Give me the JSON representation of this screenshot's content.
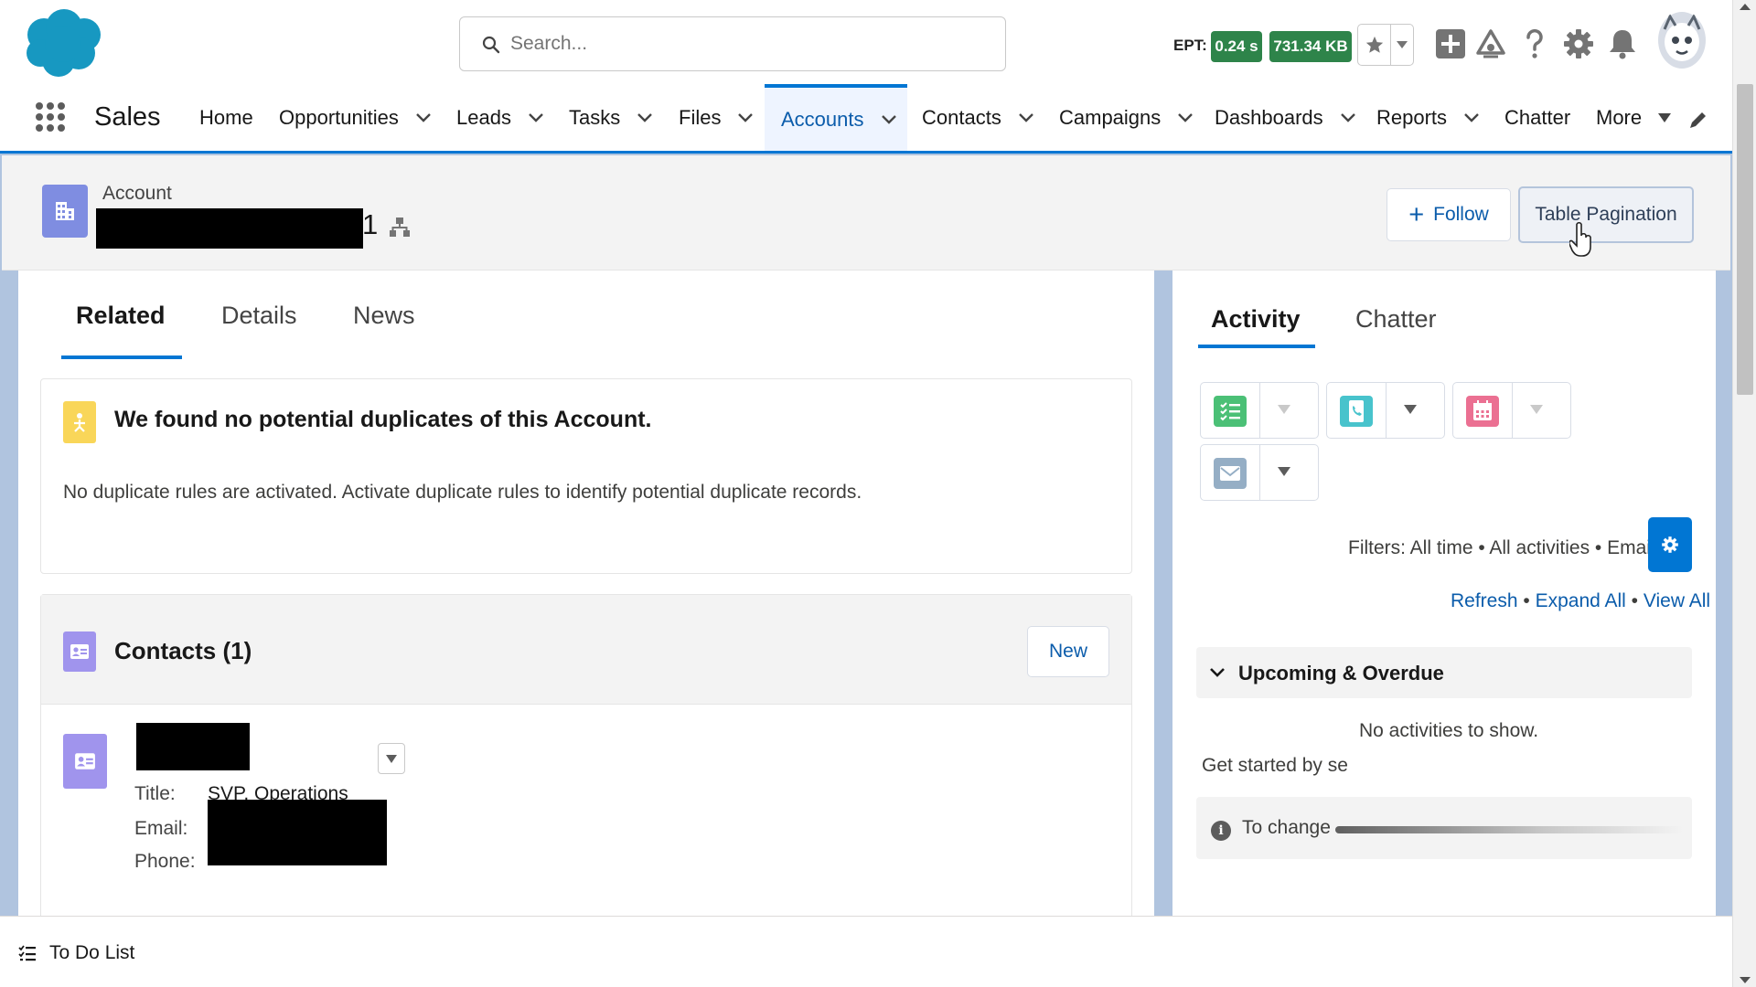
{
  "header": {
    "search": {
      "placeholder": "Search..."
    },
    "ept": {
      "label": "EPT:",
      "time": "0.24 s",
      "size": "731.34 KB"
    },
    "icons": [
      "salesforce-cloud-logo",
      "search-icon",
      "star-icon",
      "chevron-down-icon",
      "plus-square-icon",
      "trailhead-icon",
      "help-icon",
      "gear-icon",
      "bell-icon",
      "user-avatar"
    ]
  },
  "nav": {
    "app_name": "Sales",
    "items": [
      {
        "label": "Home",
        "has_menu": false
      },
      {
        "label": "Opportunities",
        "has_menu": true
      },
      {
        "label": "Leads",
        "has_menu": true
      },
      {
        "label": "Tasks",
        "has_menu": true
      },
      {
        "label": "Files",
        "has_menu": true
      },
      {
        "label": "Accounts",
        "has_menu": true,
        "active": true
      },
      {
        "label": "Contacts",
        "has_menu": true
      },
      {
        "label": "Campaigns",
        "has_menu": true
      },
      {
        "label": "Dashboards",
        "has_menu": true
      },
      {
        "label": "Reports",
        "has_menu": true
      },
      {
        "label": "Chatter",
        "has_menu": false
      },
      {
        "label": "More",
        "has_menu": true
      }
    ]
  },
  "record": {
    "object_label": "Account",
    "name_suffix": "1",
    "follow_label": "Follow",
    "custom_button_label": "Table Pagination"
  },
  "left_panel": {
    "tabs": [
      "Related",
      "Details",
      "News"
    ],
    "active_tab": "Related",
    "duplicates": {
      "title": "We found no potential duplicates of this Account.",
      "message": "No duplicate rules are activated. Activate duplicate rules to identify potential duplicate records."
    },
    "contacts": {
      "title": "Contacts (1)",
      "new_label": "New",
      "item": {
        "title_label": "Title:",
        "title_value": "SVP, Operations",
        "email_label": "Email:",
        "phone_label": "Phone:"
      }
    }
  },
  "right_panel": {
    "tabs": [
      "Activity",
      "Chatter"
    ],
    "active_tab": "Activity",
    "activity_buttons": [
      "new-task",
      "log-call",
      "new-event",
      "email"
    ],
    "filters_text": "Filters: All time • All activities • Email",
    "links": {
      "refresh": "Refresh",
      "expand_all": "Expand All",
      "view_all": "View All",
      "separator": "•"
    },
    "upcoming_title": "Upcoming & Overdue",
    "no_activities": "No activities to show.",
    "get_started": "Get started by se",
    "tip": "To change"
  },
  "utility": {
    "todo_label": "To Do List"
  },
  "colors": {
    "brand_blue": "#0176d3",
    "link_blue": "#0b5cab",
    "ept_green": "#2e844a",
    "account_icon": "#7f8de1",
    "contact_icon": "#a094ed",
    "task_green": "#4bc076",
    "call_teal": "#48c3cc",
    "event_pink": "#eb7092",
    "email_gray": "#95aec5"
  }
}
